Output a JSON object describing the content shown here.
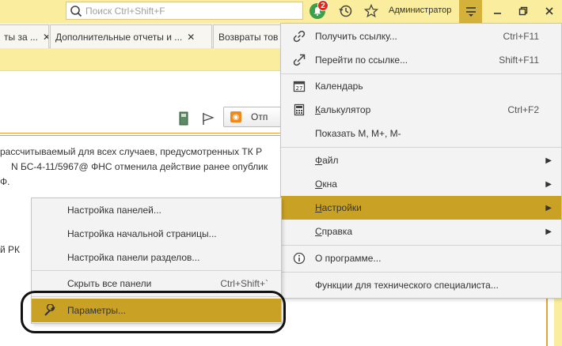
{
  "search": {
    "placeholder": "Поиск Ctrl+Shift+F"
  },
  "notifications": {
    "count": "2"
  },
  "user": {
    "name": "Администратор"
  },
  "tabs": [
    {
      "label": "ты за ..."
    },
    {
      "label": "Дополнительные отчеты и ..."
    },
    {
      "label": "Возвраты тов"
    }
  ],
  "content": {
    "button_label": "Отп",
    "lines": [
      "рассчитываемый для всех случаев, предусмотренных ТК Р",
      "N БС-4-11/5967@ ФНС отменила действие ранее опублик",
      "Ф.",
      "й РК"
    ]
  },
  "main_menu": {
    "items": [
      {
        "label": "Получить ссылку...",
        "shortcut": "Ctrl+F11",
        "icon": "link-icon"
      },
      {
        "label": "Перейти по ссылке...",
        "shortcut": "Shift+F11",
        "icon": "follow-link-icon"
      },
      {
        "label": "Календарь",
        "shortcut": "",
        "icon": "calendar-icon",
        "icon_text": "27"
      },
      {
        "label_prefix": "К",
        "label_rest": "алькулятор",
        "shortcut": "Ctrl+F2",
        "icon": "calculator-icon"
      },
      {
        "label": "Показать М, М+, М-",
        "shortcut": ""
      },
      {
        "label_prefix": "Ф",
        "label_rest": "айл"
      },
      {
        "label_prefix": "О",
        "label_rest": "кна"
      },
      {
        "label_prefix": "Н",
        "label_rest": "астройки"
      },
      {
        "label_prefix": "С",
        "label_rest": "правка"
      },
      {
        "label": "О программе...",
        "icon": "info-icon"
      },
      {
        "label": "Функции для технического специалиста..."
      }
    ]
  },
  "sub_menu": {
    "items": [
      {
        "label": "Настройка панелей..."
      },
      {
        "label": "Настройка начальной страницы..."
      },
      {
        "label": "Настройка панели разделов..."
      },
      {
        "label": "Скрыть все панели",
        "shortcut": "Ctrl+Shift+`"
      },
      {
        "label": "Параметры...",
        "icon": "wrench-icon"
      }
    ]
  },
  "colors": {
    "accent": "#c9a225",
    "header_bg": "#fbed9e",
    "badge": "#e0261b",
    "bell": "#3aa04a"
  }
}
